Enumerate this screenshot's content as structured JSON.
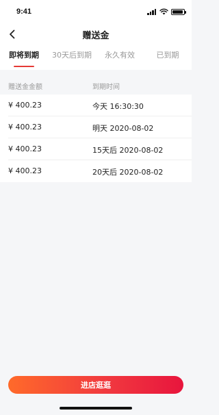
{
  "status_bar": {
    "time": "9:41",
    "icons": [
      "signal-icon",
      "wifi-icon",
      "battery-icon"
    ]
  },
  "nav": {
    "title": "赠送金",
    "back_icon": "chevron-left-icon"
  },
  "tabs": [
    {
      "label": "即将到期",
      "active": true
    },
    {
      "label": "30天后到期",
      "active": false
    },
    {
      "label": "永久有效",
      "active": false
    },
    {
      "label": "已到期",
      "active": false
    }
  ],
  "table": {
    "headers": {
      "amount": "赠送金金额",
      "expire": "到期时间"
    },
    "rows": [
      {
        "amount": "¥ 400.23",
        "expire": "今天 16:30:30"
      },
      {
        "amount": "¥ 400.23",
        "expire": "明天 2020-08-02"
      },
      {
        "amount": "¥ 400.23",
        "expire": "15天后 2020-08-02"
      },
      {
        "amount": "¥ 400.23",
        "expire": "20天后 2020-08-02"
      }
    ]
  },
  "cta": {
    "label": "进店逛逛"
  },
  "colors": {
    "accent": "#e53935",
    "gradient_start": "#ff6a2a",
    "gradient_end": "#e8153d"
  }
}
